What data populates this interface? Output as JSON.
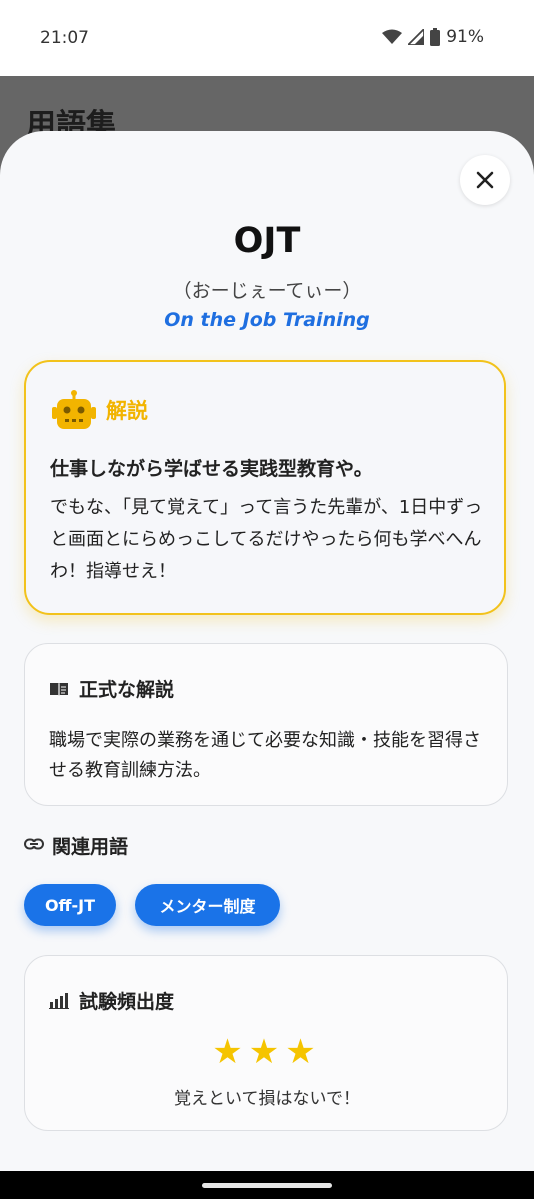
{
  "status_bar": {
    "time": "21:07",
    "battery": "91%"
  },
  "background": {
    "title": "用語集"
  },
  "term": {
    "title": "OJT",
    "reading": "（おーじぇーてぃー）",
    "english": "On the Job Training"
  },
  "explanation": {
    "heading": "解説",
    "lead": "仕事しながら学ばせる実践型教育や。",
    "body": "でもな、「見て覚えて」って言うた先輩が、1日中ずっと画面とにらめっこしてるだけやったら何も学べへんわ！指導せえ！",
    "accent_color": "#F2C21B"
  },
  "formal": {
    "heading": "正式な解説",
    "text": "職場で実際の業務を通じて必要な知識・技能を習得させる教育訓練方法。"
  },
  "related": {
    "heading": "関連用語",
    "terms": [
      "Off-JT",
      "メンター制度"
    ],
    "chip_color": "#1A73E8"
  },
  "frequency": {
    "heading": "試験頻出度",
    "stars": 3,
    "star_display": "★★★",
    "note": "覚えといて損はないで！"
  },
  "icons": {
    "close": "close-icon",
    "robot": "robot-icon",
    "book": "book-icon",
    "link": "link-icon",
    "chart": "bar-chart-icon"
  }
}
